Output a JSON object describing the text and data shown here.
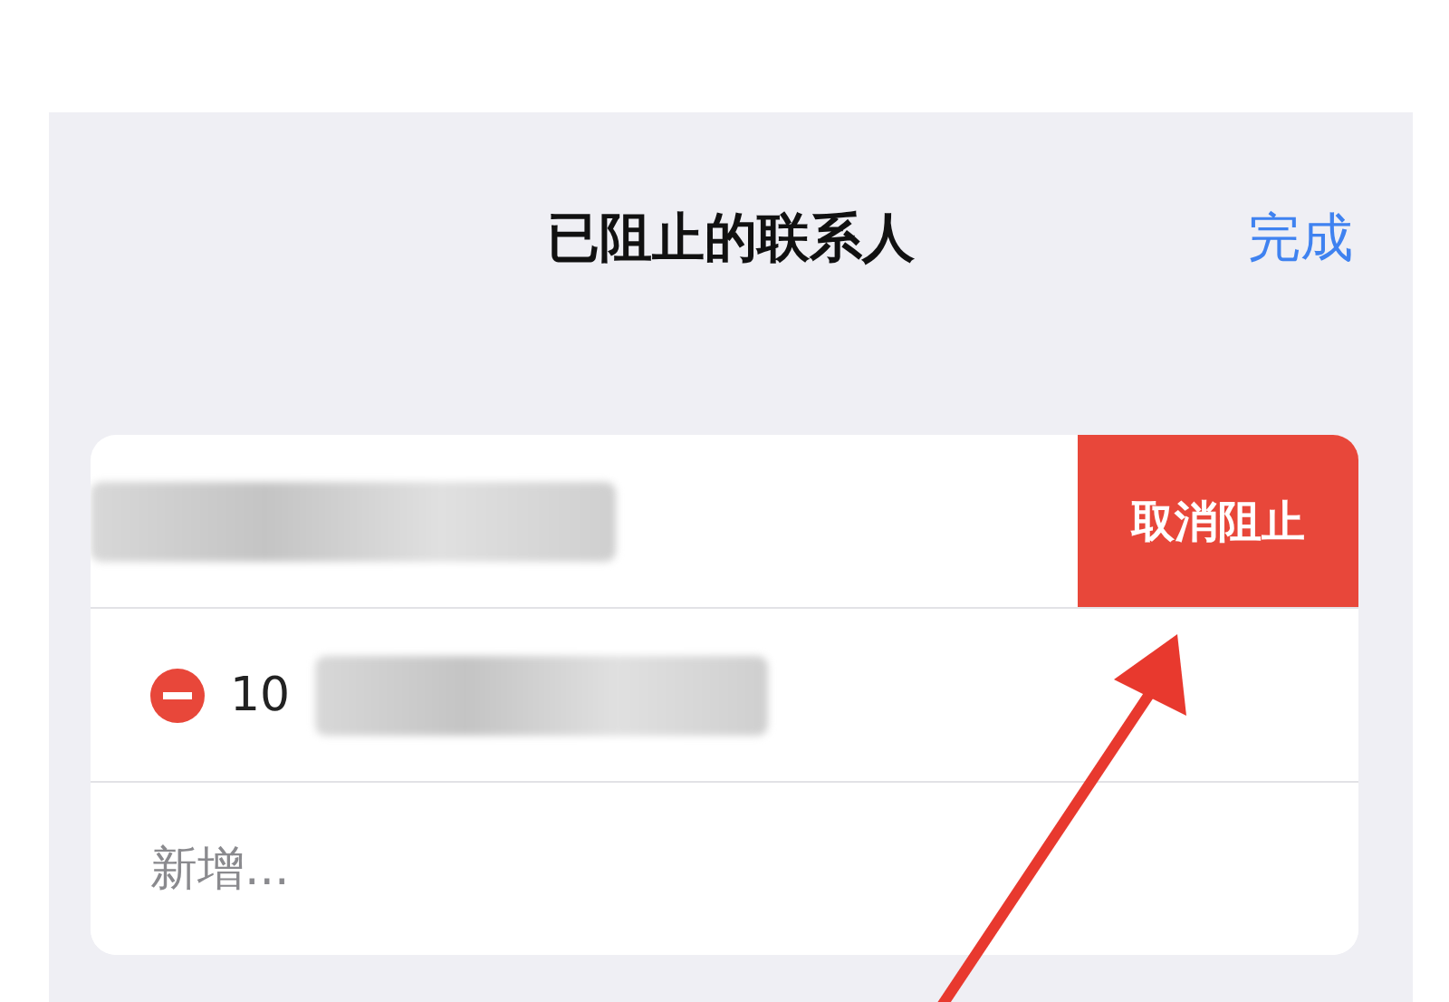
{
  "nav": {
    "title": "已阻止的联系人",
    "done": "完成"
  },
  "contacts": [
    {
      "kind": "swiped",
      "action": "取消阻止"
    },
    {
      "kind": "number",
      "number": "10"
    }
  ],
  "add": {
    "label": "新增..."
  }
}
